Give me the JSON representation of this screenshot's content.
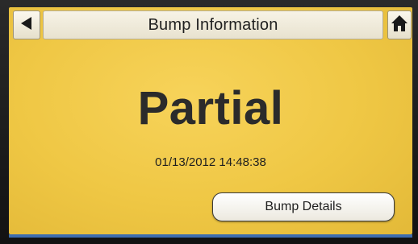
{
  "header": {
    "title": "Bump Information",
    "back_icon": "back-arrow-icon",
    "home_icon": "home-icon"
  },
  "main": {
    "status": "Partial",
    "timestamp": "01/13/2012 14:48:38",
    "details_button_label": "Bump Details"
  },
  "colors": {
    "screen_background": "#efc744",
    "status_text": "#2b2b2b"
  }
}
